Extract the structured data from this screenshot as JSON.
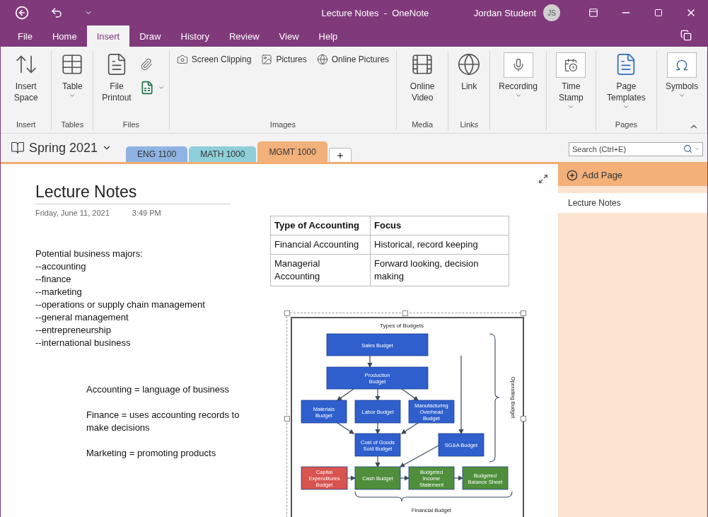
{
  "title_bar": {
    "title": "Lecture Notes  -  OneNote",
    "user": "Jordan Student",
    "avatar": "JS"
  },
  "menu_tabs": [
    {
      "label": "File",
      "selected": false
    },
    {
      "label": "Home",
      "selected": false
    },
    {
      "label": "Insert",
      "selected": true
    },
    {
      "label": "Draw",
      "selected": false
    },
    {
      "label": "History",
      "selected": false
    },
    {
      "label": "Review",
      "selected": false
    },
    {
      "label": "View",
      "selected": false
    },
    {
      "label": "Help",
      "selected": false
    }
  ],
  "ribbon_groups": [
    {
      "label": "Insert",
      "commands": [
        {
          "kind": "large",
          "label": "Insert Space"
        }
      ]
    },
    {
      "label": "Tables",
      "commands": [
        {
          "kind": "large",
          "label": "Table",
          "dropdown": true
        }
      ]
    },
    {
      "label": "Files",
      "commands": [
        {
          "kind": "large",
          "label": "File Printout"
        },
        {
          "kind": "iconstack",
          "dropdown": true
        }
      ]
    },
    {
      "label": "Images",
      "commands": [
        {
          "kind": "small",
          "label": "Screen Clipping"
        },
        {
          "kind": "small",
          "label": "Pictures"
        },
        {
          "kind": "small",
          "label": "Online Pictures"
        }
      ]
    },
    {
      "label": "Media",
      "commands": [
        {
          "kind": "large",
          "label": "Online Video"
        }
      ]
    },
    {
      "label": "Links",
      "commands": [
        {
          "kind": "large",
          "label": "Link"
        }
      ]
    },
    {
      "commands": [
        {
          "kind": "boxed",
          "label": "Recording",
          "dropdown": true
        }
      ]
    },
    {
      "commands": [
        {
          "kind": "boxed",
          "label": "Time Stamp",
          "dropdown": true
        }
      ]
    },
    {
      "label": "Pages",
      "commands": [
        {
          "kind": "large",
          "label": "Page Templates",
          "dropdown": true
        }
      ]
    },
    {
      "commands": [
        {
          "kind": "boxed",
          "label": "Symbols",
          "dropdown": true
        }
      ]
    }
  ],
  "notebook": {
    "name": "Spring 2021",
    "sections": [
      {
        "label": "ENG 1100",
        "color": "#8fb4e3",
        "selected": false
      },
      {
        "label": "MATH 1000",
        "color": "#8ecfd9",
        "selected": false
      },
      {
        "label": "MGMT 1000",
        "color": "#f2b07b",
        "selected": true
      }
    ],
    "search": {
      "placeholder": "Search (Ctrl+E)"
    }
  },
  "page": {
    "title": "Lecture Notes",
    "date": "Friday, June 11, 2021",
    "time": "3:49 PM",
    "majors": [
      "Potential business majors:",
      "--accounting",
      "--finance",
      "--marketing",
      "--operations or supply chain management",
      "--general management",
      "--entrepreneurship",
      "--international business"
    ],
    "notes": [
      "Accounting = language of business",
      "Finance = uses accounting records to make decisions",
      "Marketing = promoting products"
    ],
    "table": {
      "columns": [
        "Type of Accounting",
        "Focus"
      ],
      "rows": [
        [
          "Financial Accounting",
          "Historical, record keeping"
        ],
        [
          "Managerial Accounting",
          "Forward looking, decision making"
        ]
      ]
    },
    "diagram": {
      "title": "Types of Budgets",
      "operating_label": "Operating Budget",
      "financial_label": "Financial Budget",
      "nodes": [
        {
          "label": "Sales Budget",
          "color": "#2f5fcd"
        },
        {
          "label": "Production Budget",
          "color": "#2f5fcd"
        },
        {
          "label": "Materials Budget",
          "color": "#2f5fcd"
        },
        {
          "label": "Labor Budget",
          "color": "#2f5fcd"
        },
        {
          "label": "Manufacturing Overhead Budget",
          "color": "#2f5fcd"
        },
        {
          "label": "Cost of Goods Sold Budget",
          "color": "#2f5fcd"
        },
        {
          "label": "SG&A Budget",
          "color": "#2f5fcd"
        },
        {
          "label": "Capital Expenditures Budget",
          "color": "#d9534f"
        },
        {
          "label": "Cash Budget",
          "color": "#4f8f3b"
        },
        {
          "label": "Budgeted Income Statement",
          "color": "#4f8f3b"
        },
        {
          "label": "Budgeted Balance Sheet",
          "color": "#4f8f3b"
        }
      ]
    }
  },
  "sidebar": {
    "add_page": "Add Page",
    "pages": [
      {
        "label": "Lecture Notes",
        "selected": true
      }
    ]
  }
}
